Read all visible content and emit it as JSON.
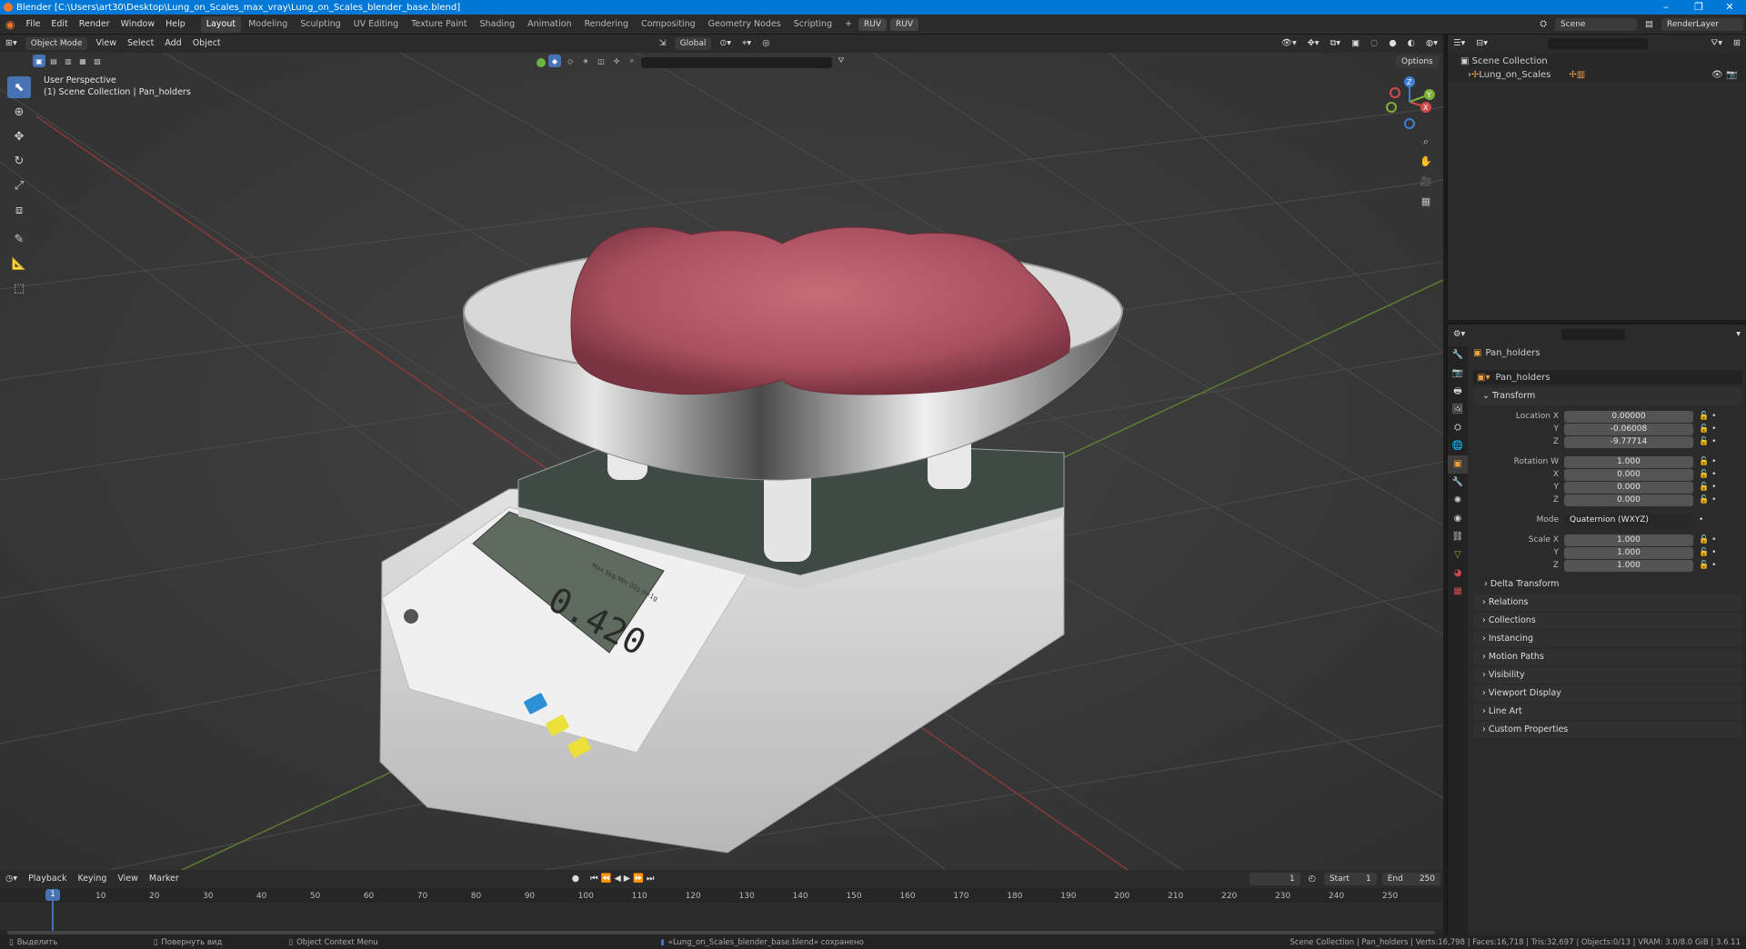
{
  "window": {
    "title": "Blender [C:\\Users\\art30\\Desktop\\Lung_on_Scales_max_vray\\Lung_on_Scales_blender_base.blend]",
    "controls": [
      "–",
      "❐",
      "✕"
    ]
  },
  "menu": [
    "File",
    "Edit",
    "Render",
    "Window",
    "Help"
  ],
  "workspaces": [
    "Layout",
    "Modeling",
    "Sculpting",
    "UV Editing",
    "Texture Paint",
    "Shading",
    "Animation",
    "Rendering",
    "Compositing",
    "Geometry Nodes",
    "Scripting"
  ],
  "workspace_add": "+",
  "header_pills": [
    "RUV",
    "RUV"
  ],
  "scene": {
    "label": "Scene",
    "render_layer": "RenderLayer"
  },
  "viewport_header": {
    "mode": "Object Mode",
    "menus": [
      "View",
      "Select",
      "Add",
      "Object"
    ],
    "orientation": "Global",
    "options": "Options"
  },
  "viewport": {
    "perspective": "User Perspective",
    "collection_path": "(1) Scene Collection | Pan_holders",
    "scale_display": "0.420",
    "scale_label": "Max 5kg  Min 20g  d=1g"
  },
  "gizmo": {
    "x": "X",
    "y": "Y",
    "z": "Z"
  },
  "outliner": {
    "root": "Scene Collection",
    "items": [
      {
        "name": "Lung_on_Scales"
      }
    ]
  },
  "properties": {
    "object_name": "Pan_holders",
    "data_name": "Pan_holders",
    "transform": {
      "header": "Transform",
      "location_label": "Location X",
      "location": [
        "0.00000",
        "-0.06008",
        "-9.77714"
      ],
      "rotation_label": "Rotation W",
      "rotation": [
        "1.000",
        "0.000",
        "0.000",
        "0.000"
      ],
      "mode_label": "Mode",
      "mode": "Quaternion (WXYZ)",
      "scale_label": "Scale X",
      "scale": [
        "1.000",
        "1.000",
        "1.000"
      ],
      "axis_labels": [
        "Y",
        "Z",
        "X",
        "Y",
        "Z"
      ]
    },
    "subpanels": [
      "Delta Transform",
      "Relations",
      "Collections",
      "Instancing",
      "Motion Paths",
      "Visibility",
      "Viewport Display",
      "Line Art",
      "Custom Properties"
    ]
  },
  "timeline": {
    "menus": [
      "Playback",
      "Keying",
      "View",
      "Marker"
    ],
    "current_frame": "1",
    "start_label": "Start",
    "start": "1",
    "end_label": "End",
    "end": "250",
    "frame_marks": [
      "1",
      "10",
      "20",
      "30",
      "40",
      "50",
      "60",
      "70",
      "80",
      "90",
      "100",
      "110",
      "120",
      "130",
      "140",
      "150",
      "160",
      "170",
      "180",
      "190",
      "200",
      "210",
      "220",
      "230",
      "240",
      "250"
    ]
  },
  "status": {
    "left1": "Выделить",
    "left2": "Повернуть вид",
    "left3": "Object Context Menu",
    "center": "«Lung_on_Scales_blender_base.blend» сохранено",
    "right": "Scene Collection | Pan_holders | Verts:16,798 | Faces:16,718 | Tris:32,697 | Objects:0/13 | VRAM: 3.0/8.0 GiB | 3.6.11"
  },
  "colors": {
    "accent": "#4772b3",
    "title_blue": "#0078d7",
    "axis_x": "#d24b4b",
    "axis_y": "#7fb13b",
    "axis_z": "#3e7fd6",
    "frame_blue": "#4772b3"
  }
}
